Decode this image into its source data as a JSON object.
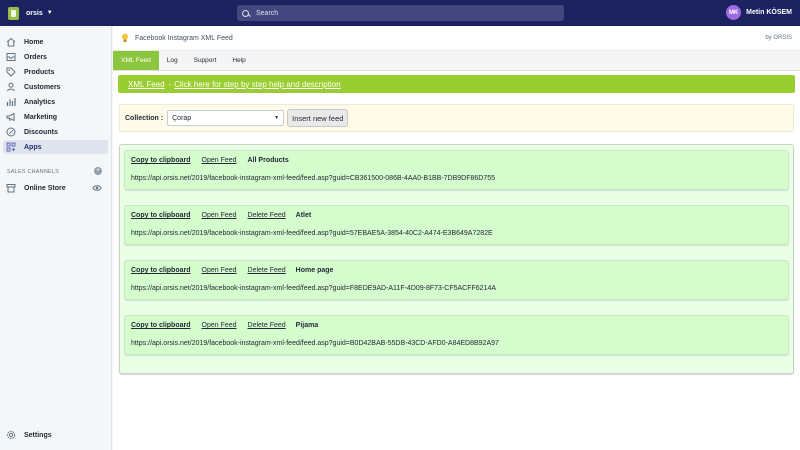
{
  "topbar": {
    "store_name": "orsis",
    "search_placeholder": "Search",
    "user_initials": "MK",
    "user_name": "Metin KÖSEM"
  },
  "sidebar": {
    "items": [
      {
        "label": "Home",
        "icon": "home-icon"
      },
      {
        "label": "Orders",
        "icon": "orders-icon"
      },
      {
        "label": "Products",
        "icon": "tag-icon"
      },
      {
        "label": "Customers",
        "icon": "person-icon"
      },
      {
        "label": "Analytics",
        "icon": "chart-icon"
      },
      {
        "label": "Marketing",
        "icon": "megaphone-icon"
      },
      {
        "label": "Discounts",
        "icon": "discount-icon"
      },
      {
        "label": "Apps",
        "icon": "apps-icon"
      }
    ],
    "active_item": "Apps",
    "sales_channels_header": "SALES CHANNELS",
    "online_store_label": "Online Store",
    "settings_label": "Settings"
  },
  "app": {
    "title": "Facebook Instagram XML Feed",
    "byline": "by ORSIS",
    "tabs": [
      "XML Feed",
      "Log",
      "Support",
      "Help"
    ],
    "active_tab": "XML Feed",
    "banner_link": "XML Feed",
    "banner_separator": "-",
    "banner_help": "Click here for step by step help and description",
    "collection_label": "Collection :",
    "collection_selected": "Çorap",
    "insert_button": "Insert new feed",
    "feeds": [
      {
        "copy": "Copy to clipboard",
        "open": "Open Feed",
        "delete": "",
        "name": "All Products",
        "url": "https://api.orsis.net/2019/facebook-instagram-xml-feed/feed.asp?guid=CB361500-086B-4AA0-B1BB-7DB9DF86D755"
      },
      {
        "copy": "Copy to clipboard",
        "open": "Open Feed",
        "delete": "Delete Feed",
        "name": "Atlet",
        "url": "https://api.orsis.net/2019/facebook-instagram-xml-feed/feed.asp?guid=57EBAE5A-3854-40C2-A474-E3B649A7282E"
      },
      {
        "copy": "Copy to clipboard",
        "open": "Open Feed",
        "delete": "Delete Feed",
        "name": "Home page",
        "url": "https://api.orsis.net/2019/facebook-instagram-xml-feed/feed.asp?guid=F8EDE9AD-A11F-4D09-8F73-CF5ACFF6214A"
      },
      {
        "copy": "Copy to clipboard",
        "open": "Open Feed",
        "delete": "Delete Feed",
        "name": "Pijama",
        "url": "https://api.orsis.net/2019/facebook-instagram-xml-feed/feed.asp?guid=B0D42BAB-55DB-43CD-AFD0-A84ED8B92A97"
      }
    ]
  },
  "colors": {
    "topbar": "#1c2260",
    "accent_green": "#9acd32",
    "feed_bg": "#d5fccd",
    "avatar": "#9c6ade"
  }
}
